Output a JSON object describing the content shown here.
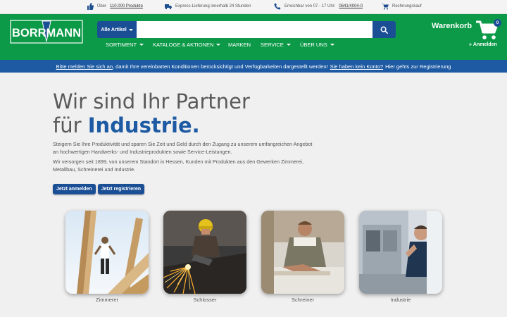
{
  "topbar": {
    "products_prefix": "Über",
    "products_link": "110.000 Produkte",
    "delivery": "Express-Lieferung innerhalb 24 Stunden",
    "reachable_prefix": "Erreichbar von 07 - 17 Uhr:",
    "phone": "0641/4004-0",
    "invoice": "Rechnungskauf"
  },
  "header": {
    "logo_text": "BORRMANN",
    "category_select": "Alle Artikel",
    "search_placeholder": "",
    "cart_label": "Warenkorb",
    "cart_count": "0",
    "login_label": "Anmelden"
  },
  "nav": {
    "items": [
      {
        "label": "SORTIMENT",
        "dropdown": true
      },
      {
        "label": "KATALOGE & AKTIONEN",
        "dropdown": true
      },
      {
        "label": "MARKEN",
        "dropdown": false
      },
      {
        "label": "SERVICE",
        "dropdown": true
      },
      {
        "label": "ÜBER UNS",
        "dropdown": true
      }
    ]
  },
  "notice": {
    "login_link": "Bitte melden Sie sich an",
    "middle": ", damit Ihre vereinbarten Konditionen berücksichtigt und Verfügbarkeiten dargestellt werden!",
    "no_account_link": "Sie haben kein Konto?",
    "register": "Hier gehts zur Registrierung"
  },
  "hero": {
    "title_line1": "Wir sind Ihr Partner",
    "title_line2_prefix": "für",
    "title_line2_accent": "Industrie.",
    "paragraph1": "Steigern Sie Ihre Produktivität und sparen Sie Zeit und Geld durch den Zugang zu unserem umfangreichen Angebot an hochwertigen Handwerks- und Industrieprodukten sowie Service-Leistungen.",
    "paragraph2": "Wir versorgen seit 1899, von unserem Standort in Hessen, Kunden mit Produkten aus den Gewerken Zimmerei, Metallbau, Schreinerei und Industrie.",
    "login_button": "Jetzt anmelden",
    "register_button": "Jetzt registrieren"
  },
  "categories": [
    {
      "label": "Zimmerer"
    },
    {
      "label": "Schlosser"
    },
    {
      "label": "Schreiner"
    },
    {
      "label": "Industrie"
    }
  ],
  "colors": {
    "header_green": "#0c9a48",
    "brand_blue": "#1b4f95",
    "notice_blue": "#1d5aa3"
  }
}
